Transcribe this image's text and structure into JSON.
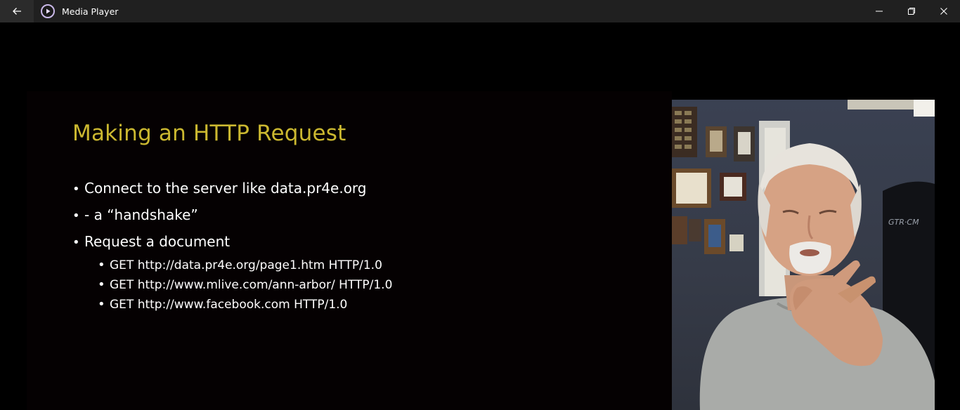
{
  "window": {
    "title": "Media Player",
    "accent": "#cbb830"
  },
  "icons": {
    "back": "arrow-left-icon",
    "app": "play-circle-icon",
    "minimize": "minimize-icon",
    "restore": "restore-icon",
    "close": "close-icon"
  },
  "slide": {
    "title": "Making an HTTP Request",
    "bullets": [
      "Connect to the server like data.pr4e.org",
      "-  a “handshake”",
      "Request a document"
    ],
    "sub_bullets": [
      "GET http://data.pr4e.org/page1.htm HTTP/1.0",
      "GET http://www.mlive.com/ann-arbor/ HTTP/1.0",
      "GET http://www.facebook.com HTTP/1.0"
    ]
  },
  "webcam": {
    "chair_text": "GTR·CM"
  }
}
